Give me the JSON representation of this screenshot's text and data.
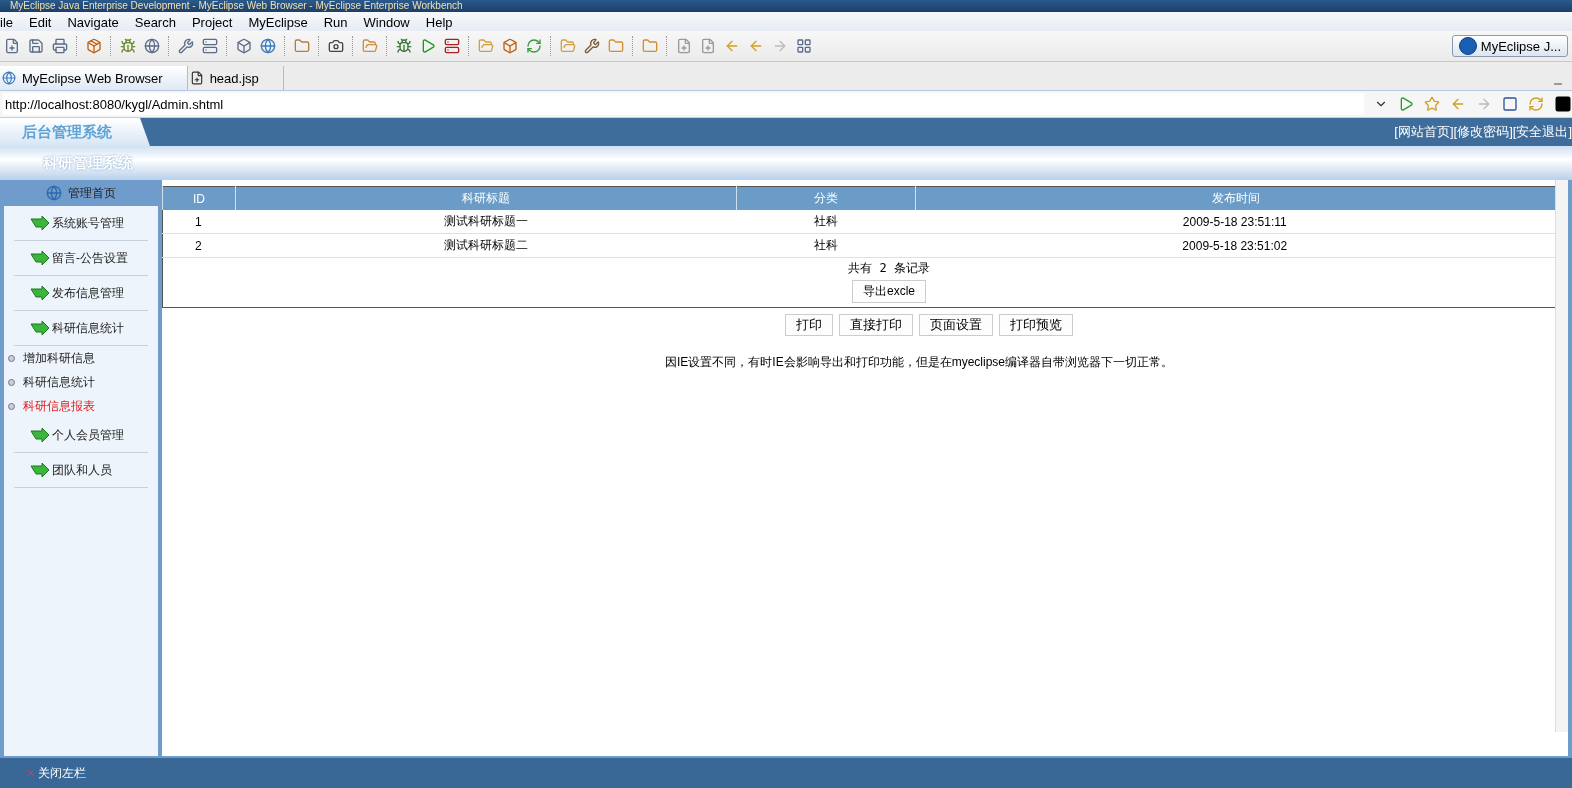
{
  "window": {
    "title": "MyEclipse Java Enterprise Development - MyEclipse Web Browser - MyEclipse Enterprise Workbench"
  },
  "menu": [
    "ile",
    "Edit",
    "Navigate",
    "Search",
    "Project",
    "MyEclipse",
    "Run",
    "Window",
    "Help"
  ],
  "perspective": {
    "label": "MyEclipse J..."
  },
  "editor_tabs": [
    {
      "label": "MyEclipse Web Browser",
      "selected": true,
      "kind": "browser"
    },
    {
      "label": "head.jsp",
      "selected": false,
      "kind": "jsp"
    }
  ],
  "address": {
    "value": "http://localhost:8080/kygl/Admin.shtml"
  },
  "page": {
    "logo": "后台管理系统",
    "subtitle": "科研管理系统",
    "top_links": [
      "[网站首页]",
      "[修改密码]",
      "[安全退出]"
    ],
    "sidebar": {
      "home": "管理首页",
      "items": [
        {
          "label": "系统账号管理"
        },
        {
          "label": "留言-公告设置"
        },
        {
          "label": "发布信息管理"
        },
        {
          "label": "科研信息统计",
          "children": [
            {
              "label": "增加科研信息",
              "selected": false
            },
            {
              "label": "科研信息统计",
              "selected": false
            },
            {
              "label": "科研信息报表",
              "selected": true
            }
          ]
        },
        {
          "label": "个人会员管理"
        },
        {
          "label": "团队和人员"
        }
      ]
    },
    "table": {
      "columns": [
        "ID",
        "科研标题",
        "分类",
        "发布时间"
      ],
      "rows": [
        [
          "1",
          "测试科研标题一",
          "社科",
          "2009-5-18 23:51:11"
        ],
        [
          "2",
          "测试科研标题二",
          "社科",
          "2009-5-18 23:51:02"
        ]
      ],
      "summary": "共有 2 条记录",
      "export_button": "导出excle"
    },
    "print_buttons": [
      "打印",
      "直接打印",
      "页面设置",
      "打印预览"
    ],
    "note": "因IE设置不同，有时IE会影响导出和打印功能，但是在myeclipse编译器自带浏览器下一切正常。",
    "close_sidebar": "关闭左栏"
  }
}
